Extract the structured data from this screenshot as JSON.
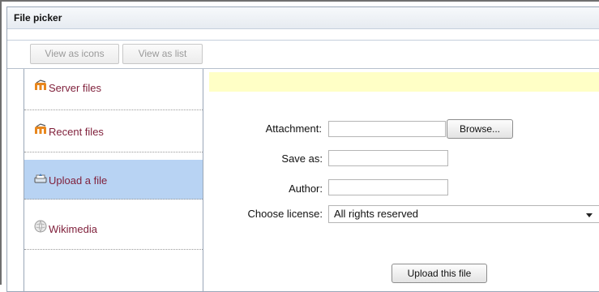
{
  "dialog": {
    "title": "File picker"
  },
  "toolbar": {
    "view_icons_label": "View as icons",
    "view_list_label": "View as list"
  },
  "sidebar": {
    "items": [
      {
        "label": "Server files",
        "icon": "moodle-icon",
        "active": false
      },
      {
        "label": "Recent files",
        "icon": "moodle-icon",
        "active": false
      },
      {
        "label": "Upload a file",
        "icon": "upload-icon",
        "active": true
      },
      {
        "label": "Wikimedia",
        "icon": "wikimedia-icon",
        "active": false
      }
    ]
  },
  "form": {
    "attachment_label": "Attachment:",
    "attachment_value": "",
    "browse_label": "Browse...",
    "save_as_label": "Save as:",
    "save_as_value": "",
    "author_label": "Author:",
    "author_value": "",
    "license_label": "Choose license:",
    "license_value": "All rights reserved",
    "upload_label": "Upload this file"
  },
  "colors": {
    "active_item_bg": "#b8d3f3",
    "notice_bg": "#ffffc6",
    "link_color": "#7f1f3a"
  }
}
